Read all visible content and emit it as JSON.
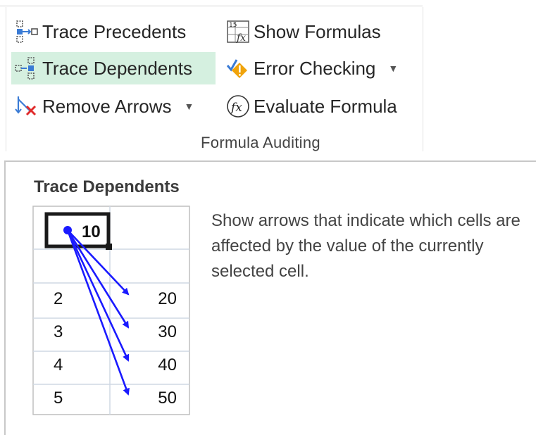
{
  "ribbon": {
    "buttons": {
      "trace_precedents": "Trace Precedents",
      "trace_dependents": "Trace Dependents",
      "remove_arrows": "Remove Arrows",
      "show_formulas": "Show Formulas",
      "error_checking": "Error Checking",
      "evaluate_formula": "Evaluate Formula"
    },
    "group_label": "Formula Auditing",
    "icons": {
      "trace_precedents": "trace-precedents-icon",
      "trace_dependents": "trace-dependents-icon",
      "remove_arrows": "remove-arrows-icon",
      "show_formulas": "show-formulas-icon",
      "error_checking": "error-checking-icon",
      "evaluate_formula": "evaluate-formula-icon"
    },
    "hover_color": "#d5f0e0"
  },
  "tooltip": {
    "title": "Trace Dependents",
    "description": "Show arrows that indicate which cells are affected by the value of the currently selected cell.",
    "illustration": {
      "selected_cell_value": "10",
      "rows": [
        {
          "left": "2",
          "right": "20"
        },
        {
          "left": "3",
          "right": "30"
        },
        {
          "left": "4",
          "right": "40"
        },
        {
          "left": "5",
          "right": "50"
        }
      ],
      "arrow_color": "#1a1aff"
    }
  }
}
